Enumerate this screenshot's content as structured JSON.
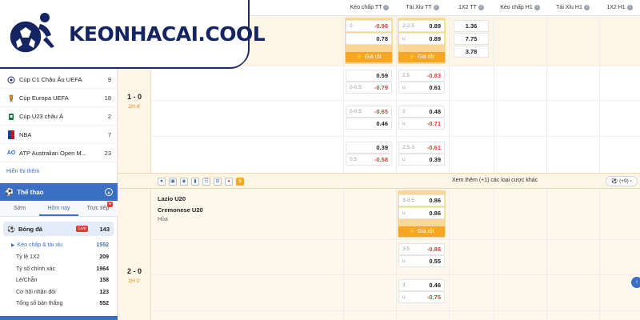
{
  "brand": {
    "name": "KEONHACAI.COOL",
    "color": "#152563"
  },
  "sidebar": {
    "leagues": [
      {
        "name": "Cúp C1 Châu Âu UEFA",
        "count": "9",
        "icon": "ucl-icon"
      },
      {
        "name": "Cúp Europa UEFA",
        "count": "18",
        "icon": "europa-icon"
      },
      {
        "name": "Cúp U23 châu Á",
        "count": "2",
        "icon": "afc-icon"
      },
      {
        "name": "NBA",
        "count": "7",
        "icon": "nba-icon"
      },
      {
        "name": "ATP Australian Open M...",
        "count": "23",
        "icon": "atp-icon"
      }
    ],
    "show_more": "Hiển thị thêm",
    "sport_section": "Thể thao",
    "time_tabs": [
      "Sớm",
      "Hôm nay",
      "Trực tiếp"
    ],
    "sport": {
      "name": "Bóng đá",
      "live": "Live",
      "count": "143"
    },
    "markets": [
      {
        "name": "Kèo chấp & tài xỉu",
        "count": "1552"
      },
      {
        "name": "Tỷ lệ 1X2",
        "count": "209"
      },
      {
        "name": "Tỷ số chính xác",
        "count": "1964"
      },
      {
        "name": "Lẻ/Chẵn",
        "count": "158"
      },
      {
        "name": "Cơ hội nhân đôi",
        "count": "123"
      },
      {
        "name": "Tổng số bàn thắng",
        "count": "552"
      }
    ]
  },
  "columns": [
    "Kèo chấp TT",
    "Tài Xỉu TT",
    "1X2 TT",
    "Kèo chấp H1",
    "Tài Xỉu H1",
    "1X2 H1"
  ],
  "best_label": "⚡ Giá tốt",
  "match1": {
    "score": "1 - 0",
    "period": "2H 4'",
    "top": {
      "hdc": [
        {
          "line": "0",
          "odd": "-0.98"
        },
        {
          "line": "",
          "odd": "0.78"
        }
      ],
      "ou": [
        {
          "line": "2-2.5",
          "odd": "0.89"
        },
        {
          "line": "u",
          "odd": "0.89"
        }
      ],
      "x12": [
        "1.36",
        "7.75",
        "3.78"
      ]
    },
    "rows": [
      {
        "hdc": [
          {
            "line": "",
            "odd": "0.59"
          },
          {
            "line": "0-0.5",
            "odd": "-0.79"
          }
        ],
        "ou": [
          {
            "line": "2.5",
            "odd": "-0.83"
          },
          {
            "line": "u",
            "odd": "0.61"
          }
        ]
      },
      {
        "hdc": [
          {
            "line": "0-0.5",
            "odd": "-0.65"
          },
          {
            "line": "",
            "odd": "0.46"
          }
        ],
        "ou": [
          {
            "line": "2",
            "odd": "0.48"
          },
          {
            "line": "u",
            "odd": "-0.71"
          }
        ]
      },
      {
        "hdc": [
          {
            "line": "",
            "odd": "0.39"
          },
          {
            "line": "0.5",
            "odd": "-0.58"
          }
        ],
        "ou": [
          {
            "line": "2.5-3",
            "odd": "-0.61"
          },
          {
            "line": "u",
            "odd": "0.39"
          }
        ]
      }
    ],
    "more_bets": "Xem thêm (+1) các loại cược khác",
    "more_count": "(+9)"
  },
  "match2": {
    "home": "Lazio U20",
    "away": "Cremonese U20",
    "draw": "Hòa",
    "score": "2 - 0",
    "period": "2H 1'",
    "top_ou": [
      {
        "line": "3-3.5",
        "odd": "0.86"
      },
      {
        "line": "u",
        "odd": "0.86"
      }
    ],
    "rows": [
      {
        "ou": [
          {
            "line": "3.5",
            "odd": "-0.88"
          },
          {
            "line": "u",
            "odd": "0.55"
          }
        ]
      },
      {
        "ou": [
          {
            "line": "3",
            "odd": "0.46"
          },
          {
            "line": "u",
            "odd": "-0.75"
          }
        ]
      }
    ]
  }
}
